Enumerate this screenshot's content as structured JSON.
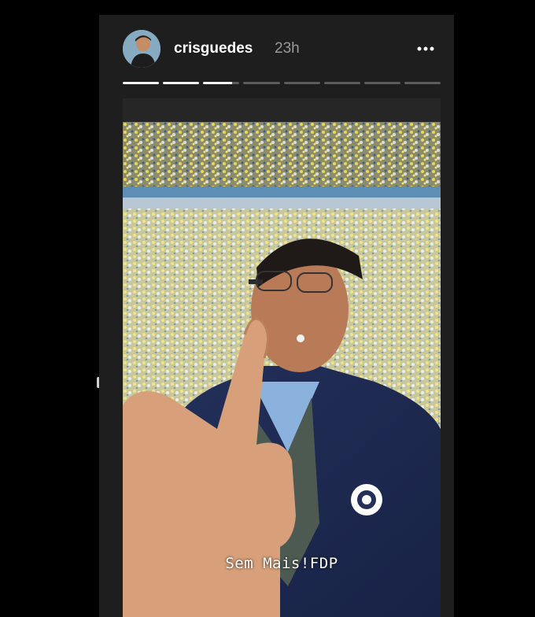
{
  "story": {
    "username": "crisguedes",
    "timestamp": "23h",
    "more_icon": "more-horizontal-icon",
    "segments": [
      1,
      1,
      0.8,
      0,
      0,
      0,
      0,
      0
    ],
    "caption": "Sem Mais!FDP"
  },
  "colors": {
    "background": "#000000",
    "frame": "#1e1e1e",
    "progress_active": "#f2f2f2",
    "progress_inactive": "#5c5c5c",
    "timestamp": "#9a9a9a"
  }
}
